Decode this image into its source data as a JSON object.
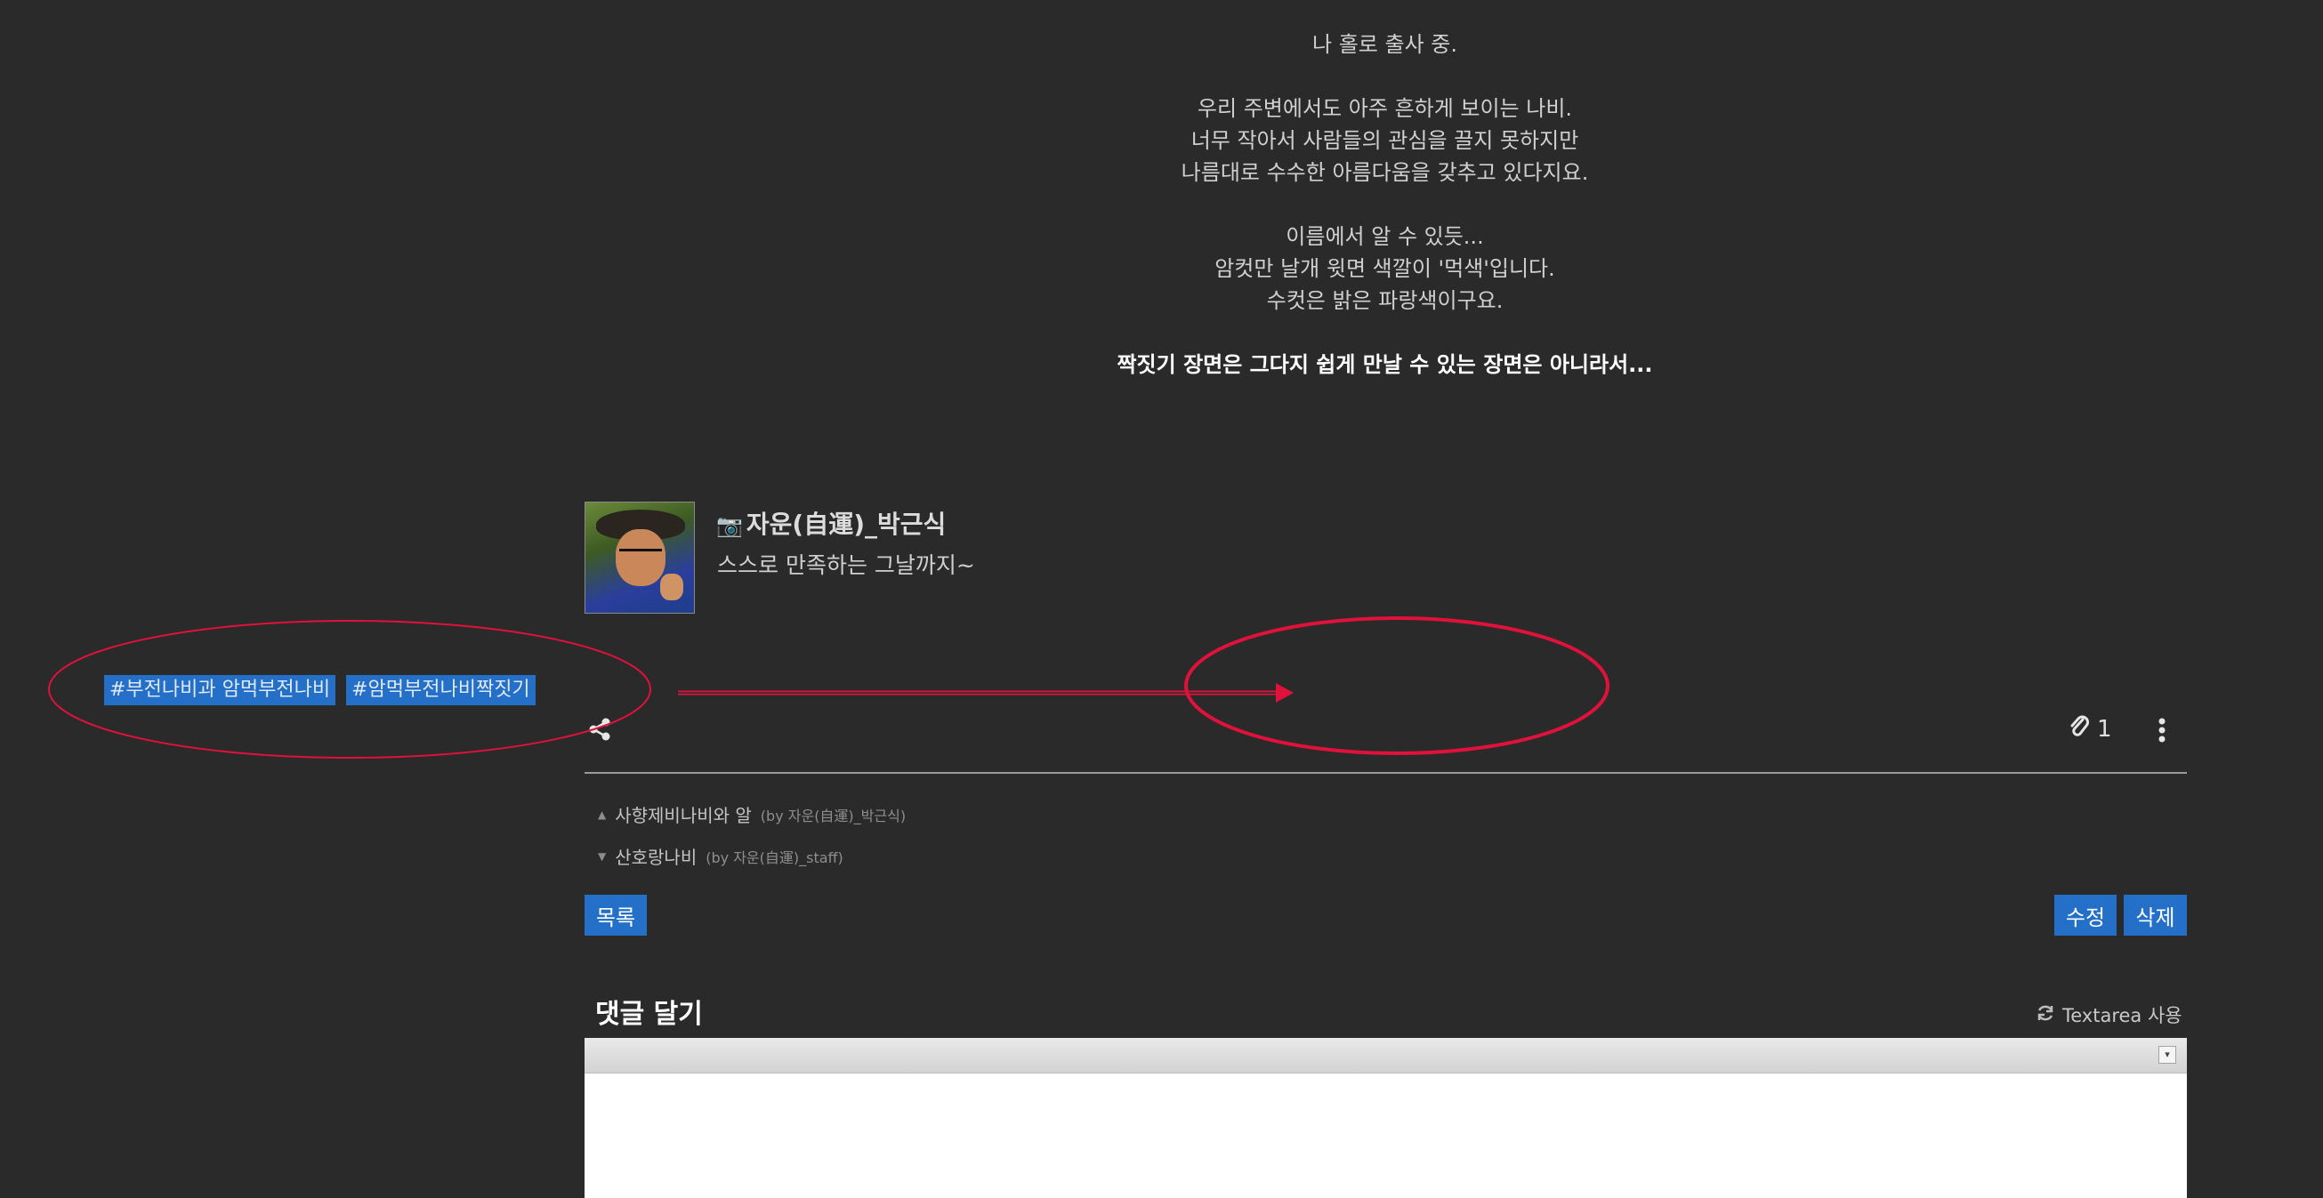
{
  "article": {
    "lines": [
      "나 홀로 출사 중.",
      "우리 주변에서도 아주 흔하게 보이는 나비.",
      "너무 작아서 사람들의 관심을 끌지 못하지만",
      "나름대로 수수한 아름다움을 갖추고 있다지요.",
      "이름에서 알 수 있듯...",
      "암컷만 날개 윗면 색깔이 '먹색'입니다.",
      "수컷은 밝은 파랑색이구요.",
      "짝짓기 장면은 그다지 쉽게 만날 수 있는 장면은 아니라서..."
    ]
  },
  "author": {
    "name": "자운(自運)_박근식",
    "bio": "스스로 만족하는 그날까지~"
  },
  "tags": [
    "#부전나비과 암먹부전나비",
    "#암먹부전나비짝짓기"
  ],
  "actions": {
    "attachment_count": "1"
  },
  "post_nav": {
    "prev": {
      "title": "사향제비나비와 알",
      "by": "(by 자운(自運)_박근식)"
    },
    "next": {
      "title": "산호랑나비",
      "by": "(by 자운(自運)_staff)"
    }
  },
  "buttons": {
    "list": "목록",
    "edit": "수정",
    "delete": "삭제"
  },
  "comment": {
    "title": "댓글 달기",
    "textarea_toggle": "Textarea 사용"
  },
  "colors": {
    "background": "#2a2a2b",
    "accent": "#2470c9",
    "annotation": "#e0113a"
  },
  "icons": [
    "camera-icon",
    "share-icon",
    "paperclip-icon",
    "more-vertical-icon",
    "refresh-icon",
    "dropdown-icon",
    "chevron-up-icon",
    "chevron-down-icon"
  ]
}
